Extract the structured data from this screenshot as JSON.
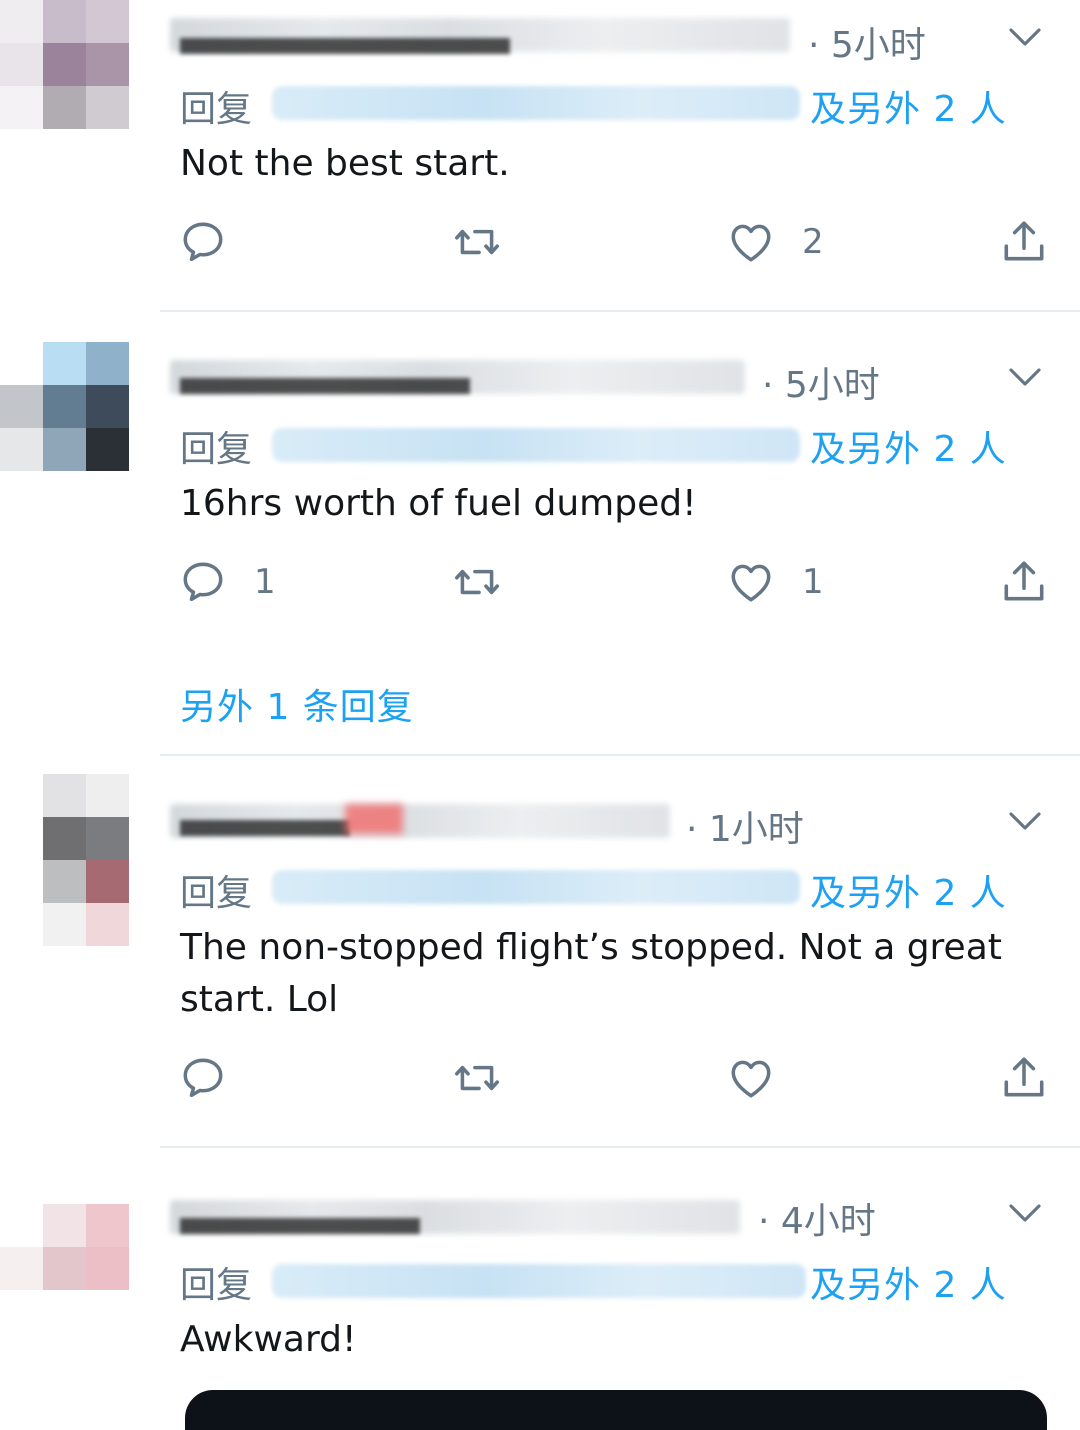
{
  "colors": {
    "accent": "#1da1f2",
    "muted": "#657786",
    "text": "#14171a",
    "divider": "#e6ecf0"
  },
  "labels": {
    "reply_prefix": "回复",
    "and_others": "及另外 2 人"
  },
  "tweets": [
    {
      "time": "· 5小时",
      "text": "Not the best start.",
      "replies": "",
      "likes": "2"
    },
    {
      "time": "· 5小时",
      "text": "16hrs worth of fuel dumped!",
      "replies": "1",
      "likes": "1",
      "more_replies": "另外 1 条回复"
    },
    {
      "time": "· 1小时",
      "text": "The non-stopped flight’s stopped. Not a great start. Lol",
      "replies": "",
      "likes": ""
    },
    {
      "time": "· 4小时",
      "text": "Awkward!"
    }
  ],
  "icons": [
    "reply-icon",
    "retweet-icon",
    "like-icon",
    "share-icon",
    "chevron-down-icon"
  ]
}
